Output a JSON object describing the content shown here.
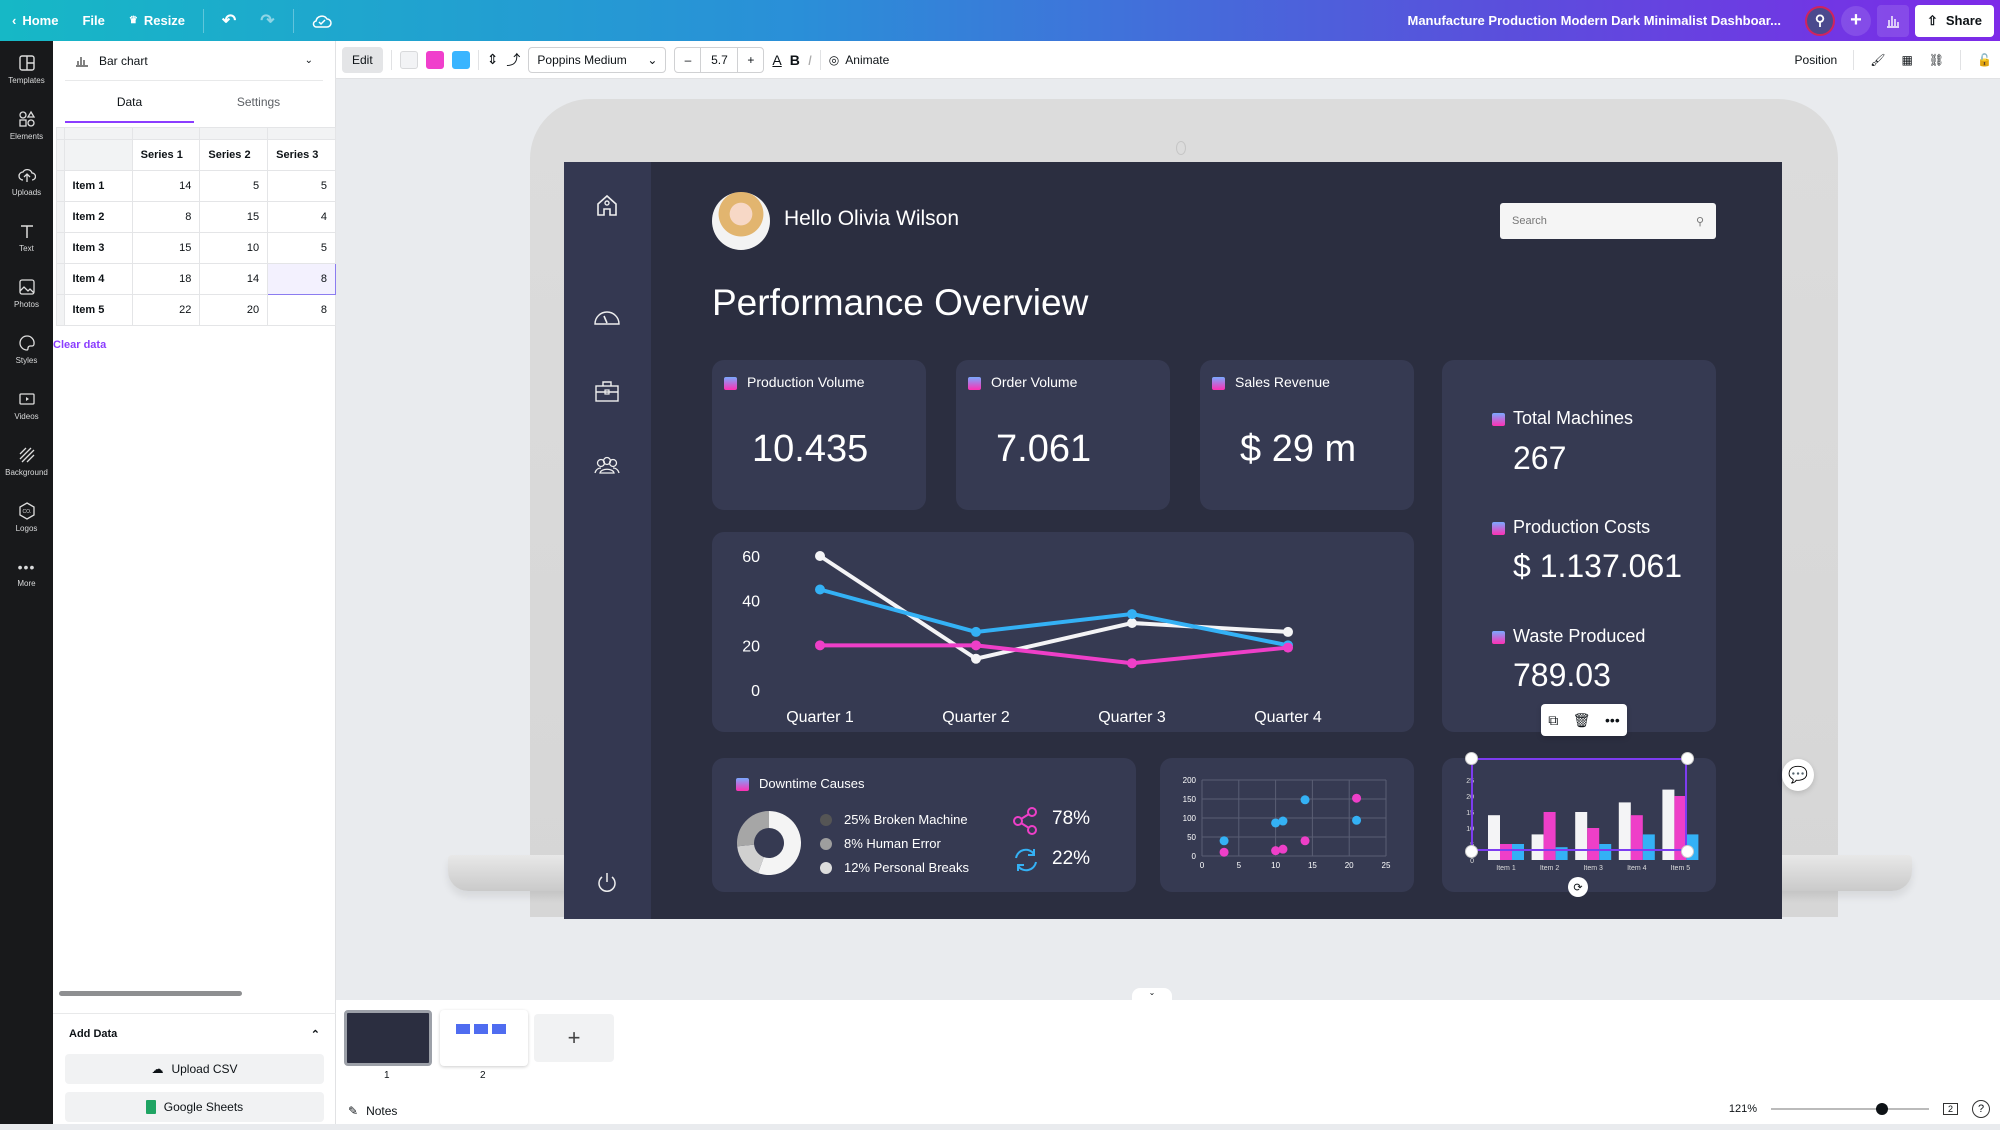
{
  "topbar": {
    "home": "Home",
    "file": "File",
    "resize": "Resize",
    "doc_title": "Manufacture Production Modern Dark Minimalist Dashboar...",
    "share": "Share"
  },
  "rail": [
    {
      "label": "Templates",
      "icon": "templates-icon"
    },
    {
      "label": "Elements",
      "icon": "elements-icon"
    },
    {
      "label": "Uploads",
      "icon": "upload-cloud-icon"
    },
    {
      "label": "Text",
      "icon": "text-icon"
    },
    {
      "label": "Photos",
      "icon": "photo-icon"
    },
    {
      "label": "Styles",
      "icon": "palette-icon"
    },
    {
      "label": "Videos",
      "icon": "video-icon"
    },
    {
      "label": "Background",
      "icon": "background-icon"
    },
    {
      "label": "Logos",
      "icon": "logo-icon"
    },
    {
      "label": "More",
      "icon": "more-icon"
    }
  ],
  "panel": {
    "chart_type": "Bar chart",
    "tabs": [
      "Data",
      "Settings"
    ],
    "active_tab": "Data",
    "table": {
      "columns": [
        "Series 1",
        "Series 2",
        "Series 3"
      ],
      "rows": [
        {
          "label": "Item 1",
          "values": [
            "14",
            "5",
            "5"
          ]
        },
        {
          "label": "Item 2",
          "values": [
            "8",
            "15",
            "4"
          ]
        },
        {
          "label": "Item 3",
          "values": [
            "15",
            "10",
            "5"
          ]
        },
        {
          "label": "Item 4",
          "values": [
            "18",
            "14",
            "8"
          ]
        },
        {
          "label": "Item 5",
          "values": [
            "22",
            "20",
            "8"
          ]
        }
      ]
    },
    "clear_data": "Clear data",
    "add_data": "Add Data",
    "upload_csv": "Upload CSV",
    "google_sheets": "Google Sheets"
  },
  "toolbar": {
    "edit": "Edit",
    "colors": [
      "#f2f3f5",
      "#f03fcc",
      "#3ab5ff"
    ],
    "font": "Poppins Medium",
    "font_size": "5.7",
    "animate": "Animate",
    "position": "Position"
  },
  "dashboard": {
    "greeting": "Hello Olivia Wilson",
    "search_placeholder": "Search",
    "title": "Performance Overview",
    "kpis": [
      {
        "title": "Production Volume",
        "value": "10.435"
      },
      {
        "title": "Order Volume",
        "value": "7.061"
      },
      {
        "title": "Sales Revenue",
        "value": "$ 29 m"
      }
    ],
    "right_kpis": [
      {
        "title": "Total Machines",
        "value": "267"
      },
      {
        "title": "Production Costs",
        "value": "$ 1.137.061"
      },
      {
        "title": "Waste Produced",
        "value": "789.03"
      }
    ],
    "downtime": {
      "title": "Downtime Causes",
      "items": [
        {
          "label": "25% Broken Machine",
          "color": "#555555"
        },
        {
          "label": "8% Human Error",
          "color": "#9e9e9e"
        },
        {
          "label": "12% Personal Breaks",
          "color": "#dddddd"
        }
      ],
      "stat1": "78%",
      "stat2": "22%"
    }
  },
  "chart_data": [
    {
      "type": "line",
      "categories": [
        "Quarter 1",
        "Quarter 2",
        "Quarter 3",
        "Quarter 4"
      ],
      "yticks": [
        "0",
        "20",
        "40",
        "60"
      ],
      "ylim": [
        0,
        60
      ],
      "series": [
        {
          "name": "white",
          "color": "#f4f4f6",
          "values": [
            60,
            14,
            30,
            26
          ]
        },
        {
          "name": "blue",
          "color": "#34b1f5",
          "values": [
            45,
            26,
            34,
            20
          ]
        },
        {
          "name": "pink",
          "color": "#ee3fc8",
          "values": [
            20,
            20,
            12,
            19
          ]
        }
      ]
    },
    {
      "type": "scatter",
      "xticks": [
        "0",
        "5",
        "10",
        "15",
        "20",
        "25"
      ],
      "yticks": [
        "0",
        "50",
        "100",
        "150",
        "200"
      ],
      "xlim": [
        0,
        25
      ],
      "ylim": [
        0,
        200
      ],
      "grid": true,
      "series": [
        {
          "name": "blue",
          "color": "#34b1f5",
          "points": [
            [
              3,
              40
            ],
            [
              10,
              87
            ],
            [
              11,
              92
            ],
            [
              14,
              148
            ],
            [
              21,
              94
            ]
          ]
        },
        {
          "name": "pink",
          "color": "#ee3fc8",
          "points": [
            [
              3,
              10
            ],
            [
              10,
              14
            ],
            [
              11,
              18
            ],
            [
              14,
              40
            ],
            [
              21,
              152
            ]
          ]
        }
      ]
    },
    {
      "type": "bar",
      "categories": [
        "Item 1",
        "Item 2",
        "Item 3",
        "Item 4",
        "Item 5"
      ],
      "yticks": [
        "0",
        "5",
        "10",
        "15",
        "20",
        "25"
      ],
      "ylim": [
        0,
        25
      ],
      "series": [
        {
          "name": "Series 1",
          "color": "#f4f4f6",
          "values": [
            14,
            8,
            15,
            18,
            22
          ]
        },
        {
          "name": "Series 2",
          "color": "#ee3fc8",
          "values": [
            5,
            15,
            10,
            14,
            20
          ]
        },
        {
          "name": "Series 3",
          "color": "#34b1f5",
          "values": [
            5,
            4,
            5,
            8,
            8
          ]
        }
      ]
    },
    {
      "type": "pie",
      "title": "Downtime Causes",
      "categories": [
        "Broken Machine",
        "Human Error",
        "Personal Breaks"
      ],
      "values": [
        25,
        8,
        12
      ]
    }
  ],
  "pages": {
    "labels": [
      "1",
      "2"
    ],
    "notes": "Notes",
    "zoom": "121%",
    "zoom_fraction": 0.7,
    "page_count": "2"
  }
}
